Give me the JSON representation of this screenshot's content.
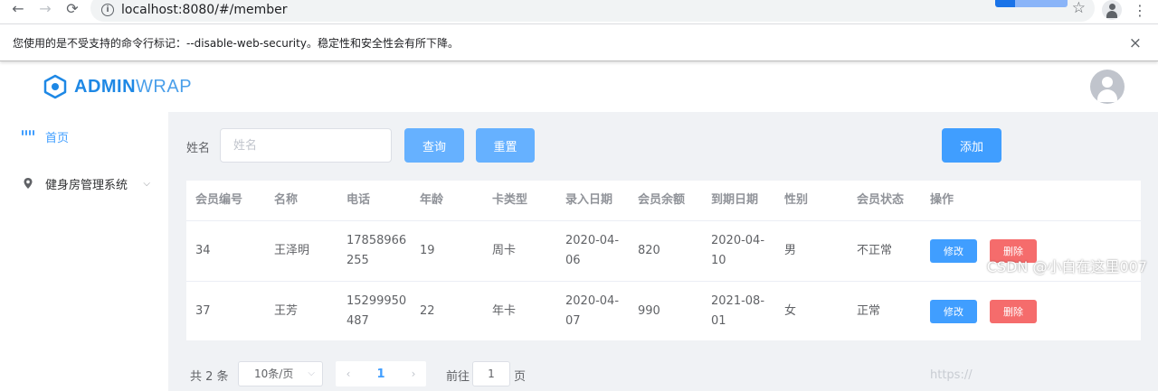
{
  "browser": {
    "back": "←",
    "forward": "→",
    "reload": "⟳",
    "url": "localhost:8080/#/member",
    "star": "☆",
    "menu": "⋮"
  },
  "infobar": {
    "message": "您使用的是不受支持的命令行标记：--disable-web-security。稳定性和安全性会有所下降。",
    "close": "×"
  },
  "app": {
    "logo_bold": "ADMIN",
    "logo_light": "WRAP",
    "brand_color": "#1e88e5"
  },
  "sidebar": {
    "items": [
      {
        "label": "首页",
        "icon": "grid-icon"
      },
      {
        "label": "健身房管理系统",
        "icon": "location-icon"
      }
    ]
  },
  "search": {
    "label": "姓名",
    "placeholder": "姓名",
    "value": "",
    "query_label": "查询",
    "reset_label": "重置",
    "add_label": "添加"
  },
  "table": {
    "columns": [
      "会员编号",
      "名称",
      "电话",
      "年龄",
      "卡类型",
      "录入日期",
      "会员余额",
      "到期日期",
      "性别",
      "会员状态",
      "操作"
    ],
    "rows": [
      {
        "id": "34",
        "name": "王泽明",
        "phone_1": "17858966",
        "phone_2": "255",
        "age": "19",
        "card": "周卡",
        "entry_1": "2020-04-",
        "entry_2": "06",
        "balance": "820",
        "expire_1": "2020-04-",
        "expire_2": "10",
        "gender": "男",
        "status": "不正常"
      },
      {
        "id": "37",
        "name": "王芳",
        "phone_1": "15299950",
        "phone_2": "487",
        "age": "22",
        "card": "年卡",
        "entry_1": "2020-04-",
        "entry_2": "07",
        "balance": "990",
        "expire_1": "2021-08-",
        "expire_2": "01",
        "gender": "女",
        "status": "正常"
      }
    ],
    "edit_label": "修改",
    "delete_label": "删除"
  },
  "pagination": {
    "total": "共 2 条",
    "page_size": "10条/页",
    "prev": "‹",
    "next": "›",
    "current_page": "1",
    "goto_label": "前往",
    "goto_value": "1",
    "goto_unit": "页"
  },
  "watermark": {
    "text": "CSDN @小白在这里007",
    "faint": "https://"
  }
}
